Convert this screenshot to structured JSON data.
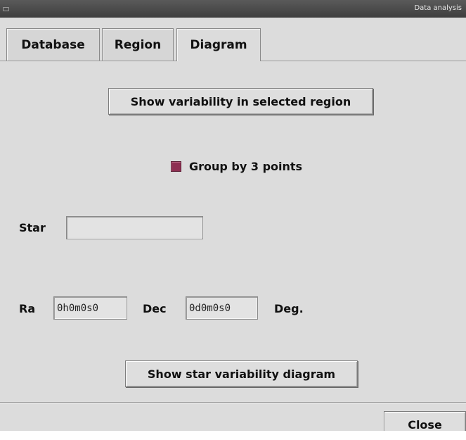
{
  "window": {
    "title": "Data analysis"
  },
  "tabs": [
    {
      "label": "Database"
    },
    {
      "label": "Region"
    },
    {
      "label": "Diagram",
      "active": true
    }
  ],
  "diagram": {
    "show_region_button": "Show variability in selected region",
    "group_checkbox": {
      "label": "Group by 3 points",
      "checked": true,
      "color": "#8e2f52"
    },
    "star_label": "Star",
    "star_value": "",
    "ra_label": "Ra",
    "ra_value": "0h0m0s0",
    "dec_label": "Dec",
    "dec_value": "0d0m0s0",
    "deg_label": "Deg.",
    "show_star_button": "Show star variability diagram"
  },
  "footer": {
    "close_label": "Close"
  }
}
